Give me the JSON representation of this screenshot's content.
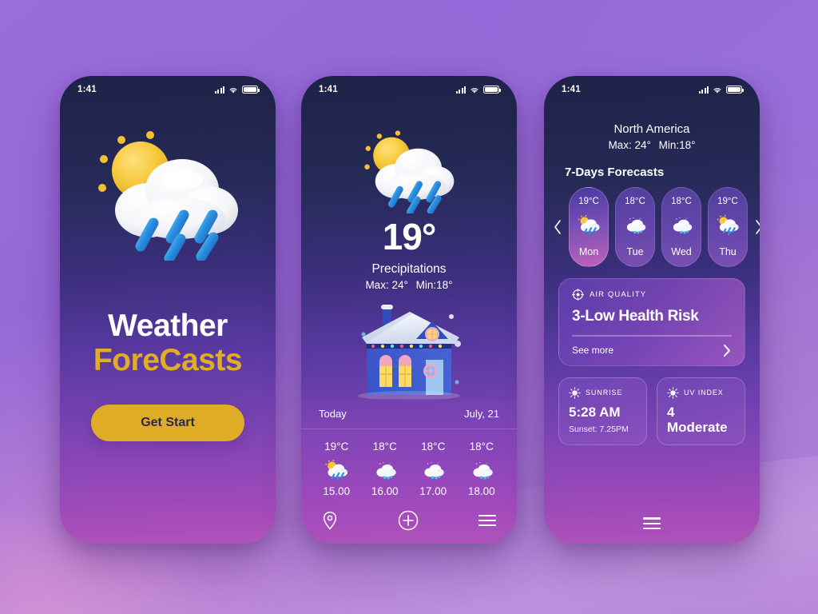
{
  "statusbar": {
    "time": "1:41",
    "signal_icon": "cellular-signal-icon",
    "wifi_icon": "wifi-icon",
    "battery_icon": "battery-icon"
  },
  "colors": {
    "accent_gold": "#dfac25",
    "dark_navy": "#1f2247",
    "magenta": "#b152bb",
    "text": "#ffffff"
  },
  "screen1": {
    "hero_icon": "sun-cloud-rain-icon",
    "title_line1": "Weather",
    "title_line2": "ForeCasts",
    "cta_label": "Get Start"
  },
  "screen2": {
    "hero_icon": "sun-cloud-rain-icon",
    "temperature": "19°",
    "condition": "Precipitations",
    "max": "Max: 24°",
    "min": "Min:18°",
    "illustration": "snowy-house-illustration",
    "panel": {
      "day_label": "Today",
      "date_label": "July, 21",
      "hours": [
        {
          "temp": "19°C",
          "icon": "sun-cloud-rain-icon",
          "time": "15.00"
        },
        {
          "temp": "18°C",
          "icon": "cloud-rain-night-icon",
          "time": "16.00"
        },
        {
          "temp": "18°C",
          "icon": "cloud-rain-night-icon",
          "time": "17.00"
        },
        {
          "temp": "18°C",
          "icon": "cloud-rain-night-icon",
          "time": "18.00"
        }
      ]
    },
    "nav": {
      "location_icon": "location-pin-icon",
      "add_icon": "plus-circle-icon",
      "menu_icon": "hamburger-menu-icon"
    }
  },
  "screen3": {
    "location": "North America",
    "max": "Max: 24°",
    "min": "Min:18°",
    "forecast_heading": "7-Days Forecasts",
    "prev_icon": "chevron-left-icon",
    "next_icon": "chevron-right-icon",
    "days": [
      {
        "temp": "19°C",
        "icon": "sun-cloud-rain-icon",
        "name": "Mon",
        "active": true
      },
      {
        "temp": "18°C",
        "icon": "cloud-rain-night-icon",
        "name": "Tue",
        "active": false
      },
      {
        "temp": "18°C",
        "icon": "cloud-rain-night-icon",
        "name": "Wed",
        "active": false
      },
      {
        "temp": "19°C",
        "icon": "sun-cloud-rain-icon",
        "name": "Thu",
        "active": false
      }
    ],
    "air_quality": {
      "icon": "air-quality-target-icon",
      "label": "AIR QUALITY",
      "value": "3-Low Health Risk",
      "more_label": "See more",
      "more_icon": "chevron-right-icon"
    },
    "sunrise": {
      "icon": "sun-rays-icon",
      "label": "SUNRISE",
      "time": "5:28 AM",
      "sunset": "Sunset: 7.25PM"
    },
    "uv": {
      "icon": "sun-rays-icon",
      "label": "UV INDEX",
      "value": "4",
      "level": "Moderate"
    },
    "menu_icon": "hamburger-menu-icon"
  }
}
